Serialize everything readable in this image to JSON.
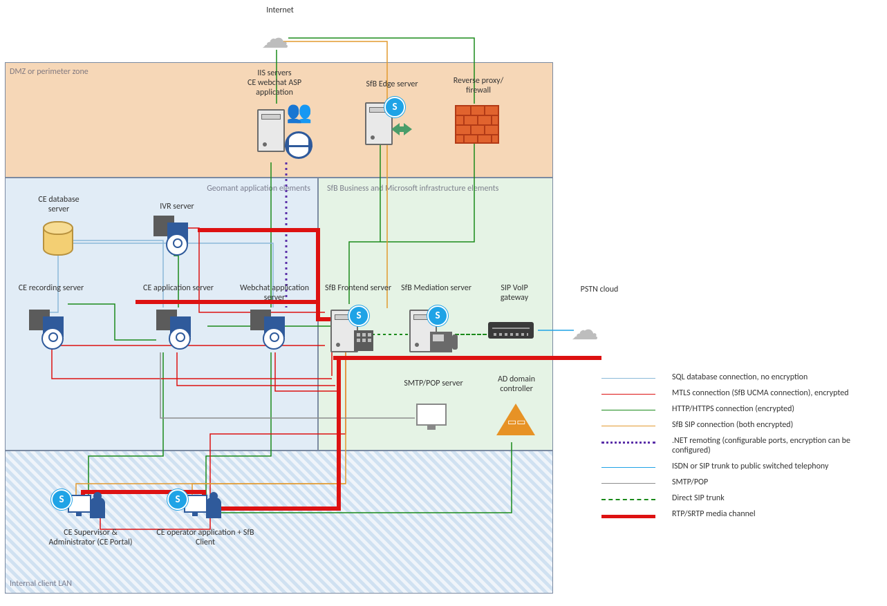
{
  "labels": {
    "internet": "Internet",
    "dmz": "DMZ or perimeter zone",
    "geomant": "Geomant application elements",
    "sfb": "SfB Business and Microsoft infrastructure elements",
    "clientlan": "Internal client LAN",
    "pstn": "PSTN cloud"
  },
  "nodes": {
    "iis": "IIS servers\nCE webchat ASP application",
    "edge": "SfB Edge server",
    "proxy": "Reverse proxy/\nfirewall",
    "cedb": "CE database server",
    "ivr": "IVR server",
    "cerec": "CE recording server",
    "ceapp": "CE application server",
    "webchat": "Webchat application server",
    "sfbfe": "SfB Frontend server",
    "sfbmed": "SfB Mediation server",
    "sipgw": "SIP VoIP gateway",
    "smtp": "SMTP/POP server",
    "adc": "AD domain controller",
    "sup": "CE Supervisor & Administrator (CE Portal)",
    "op": "CE operator application + SfB Client"
  },
  "legend": {
    "sql": "SQL database connection, no encryption",
    "mtls": "MTLS connection (SfB UCMA connection), encrypted",
    "http": "HTTP/HTTPS connection (encrypted)",
    "sip": "SfB SIP connection (both encrypted)",
    "net": ".NET remoting (configurable ports, encryption can be configured)",
    "isdn": "ISDN or SIP trunk to public switched telephony",
    "smtp": "SMTP/POP",
    "dsip": "Direct SIP trunk",
    "rtp": "RTP/SRTP media channel"
  },
  "colors": {
    "sql": "#8ab8d8",
    "mtls": "#d11",
    "http": "#1a8a1a",
    "sip": "#e29a2f",
    "net": "#5a2fa8",
    "isdn": "#1fa3e6",
    "smtp": "#8c8c8c",
    "dsip": "#1a8a1a",
    "rtp": "#d11"
  }
}
